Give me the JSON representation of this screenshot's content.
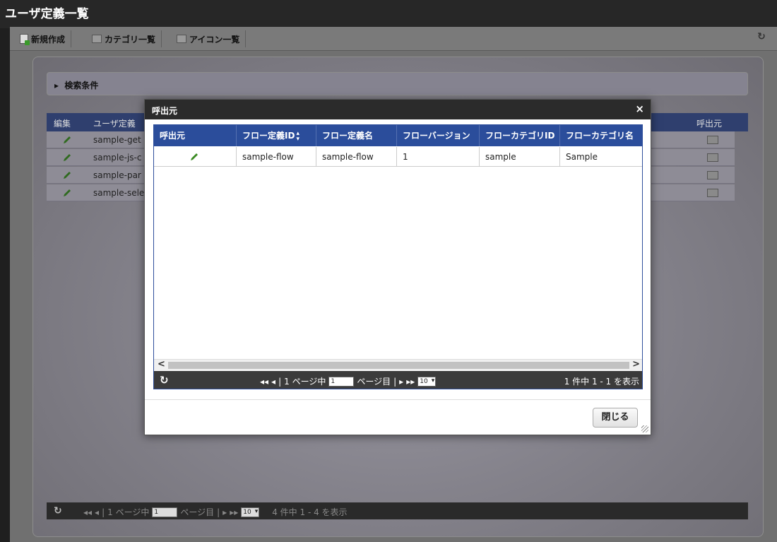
{
  "page": {
    "title": "ユーザ定義一覧"
  },
  "toolbar": {
    "new_label": "新規作成",
    "category_label": "カテゴリ一覧",
    "icon_list_label": "アイコン一覧",
    "refresh_icon": "refresh-icon"
  },
  "search": {
    "label": "検索条件"
  },
  "grid": {
    "columns": [
      "編集",
      "ユーザ定義",
      "呼出元"
    ],
    "rows": [
      {
        "name": "sample-get"
      },
      {
        "name": "sample-js-c"
      },
      {
        "name": "sample-par"
      },
      {
        "name": "sample-sele"
      }
    ],
    "pager": {
      "page_of": "1 ページ中",
      "page_value": "1",
      "page_suffix": "ページ目",
      "rows_select": "10",
      "count": "4 件中 1 - 4 を表示"
    }
  },
  "modal": {
    "title": "呼出元",
    "close_x": "×",
    "columns": [
      "呼出元",
      "フロー定義ID",
      "フロー定義名",
      "フローバージョン",
      "フローカテゴリID",
      "フローカテゴリ名"
    ],
    "rows": [
      {
        "flow_id": "sample-flow",
        "flow_name": "sample-flow",
        "version": "1",
        "category_id": "sample",
        "category_name": "Sample"
      }
    ],
    "pager": {
      "page_of": "1 ページ中",
      "page_value": "1",
      "page_suffix": "ページ目",
      "rows_select": "10",
      "count": "1 件中 1 - 1 を表示"
    },
    "close_button": "閉じる"
  }
}
